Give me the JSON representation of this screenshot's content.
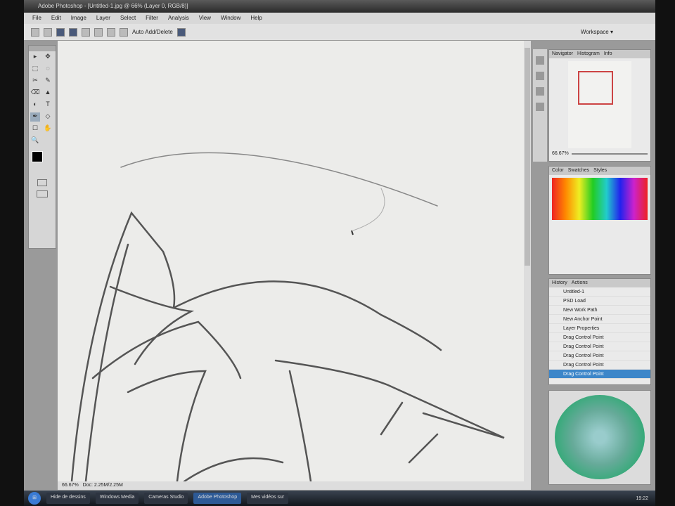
{
  "window": {
    "title": "Adobe Photoshop - [Untitled-1.jpg @ 66% (Layer 0, RGB/8)]"
  },
  "menu": [
    "File",
    "Edit",
    "Image",
    "Layer",
    "Select",
    "Filter",
    "Analysis",
    "View",
    "Window",
    "Help"
  ],
  "options": {
    "free_transform": "Auto Add/Delete",
    "workspace": "Workspace ▾"
  },
  "tools": [
    "▸",
    "✥",
    "⬚",
    "◌",
    "✂",
    "✎",
    "⌫",
    "▲",
    "◐",
    "T",
    "✒",
    "◇",
    "☐",
    "✋",
    "🔍"
  ],
  "status": {
    "zoom": "66.67%",
    "doc": "Doc: 2.25M/2.25M"
  },
  "navigator": {
    "tabs": [
      "Navigator",
      "Histogram",
      "Info"
    ],
    "zoom": "66.67%"
  },
  "swatches": {
    "tabs": [
      "Color",
      "Swatches",
      "Styles"
    ]
  },
  "history": {
    "tabs": [
      "History",
      "Actions"
    ],
    "snapshot": "Untitled-1",
    "items": [
      "PSD Load",
      "New Work Path",
      "New Anchor Point",
      "Layer Properties",
      "Drag Control Point",
      "Drag Control Point",
      "Drag Control Point",
      "Drag Control Point",
      "Drag Control Point"
    ],
    "selected_index": 8
  },
  "taskbar": {
    "start": "⊞",
    "items": [
      "Hide de dessins",
      "Windows Media",
      "Cameras Studio",
      "Adobe Photoshop",
      "Mes vidéos sur"
    ],
    "active_index": 3,
    "clock": "19:22"
  },
  "colors": {
    "accent": "#3d86c9",
    "foreground": "#000000"
  }
}
